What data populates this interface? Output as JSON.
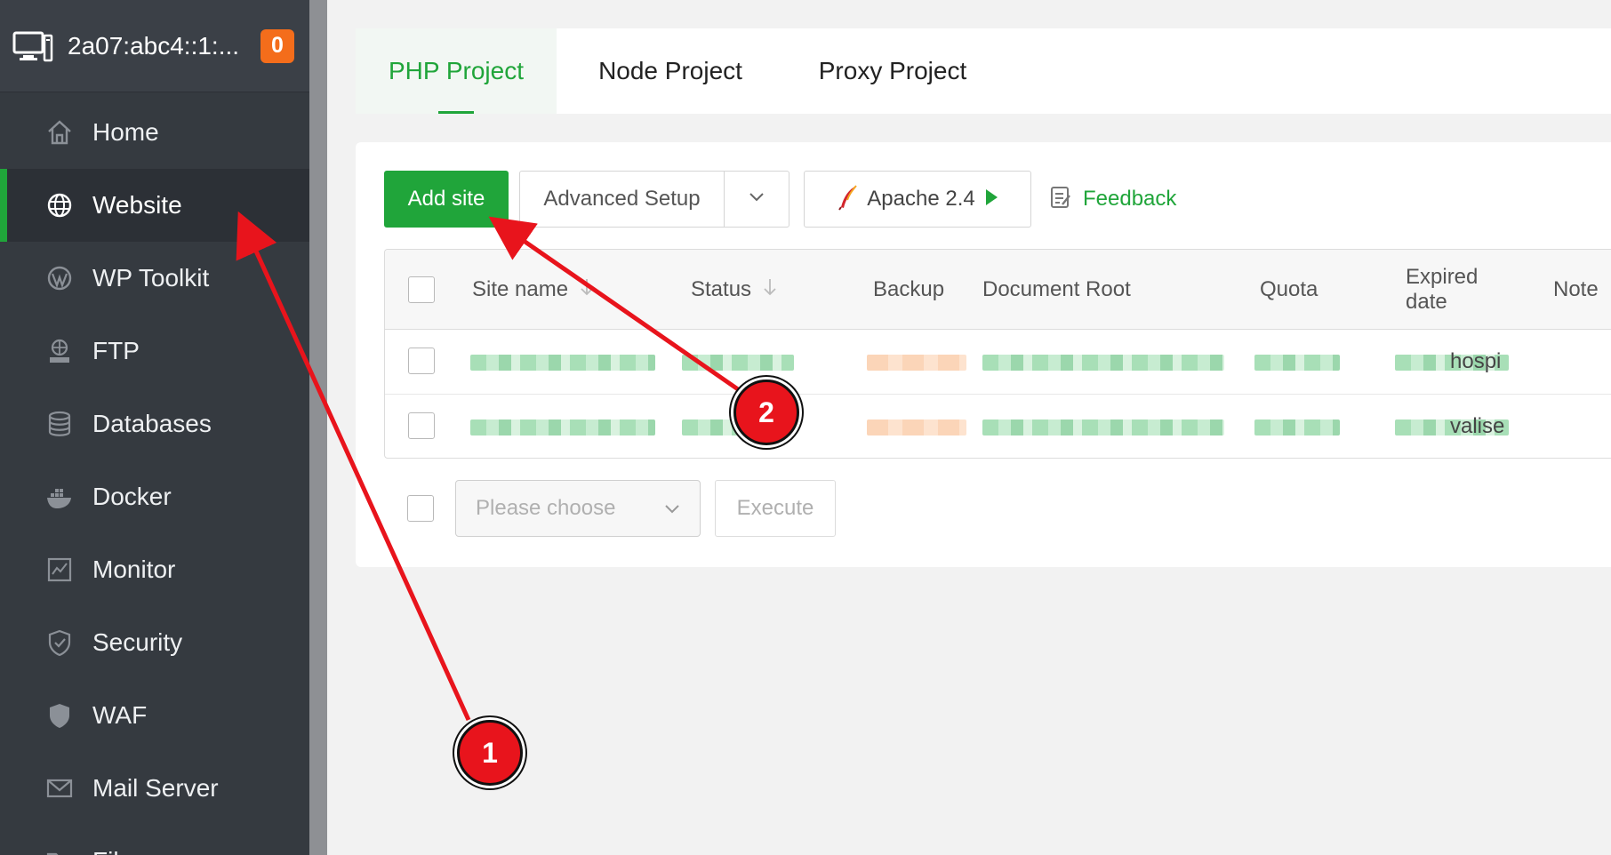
{
  "sidebar": {
    "server_name": "2a07:abc4::1:...",
    "badge_count": "0",
    "items": [
      {
        "label": "Home",
        "icon": "home-icon"
      },
      {
        "label": "Website",
        "icon": "globe-icon"
      },
      {
        "label": "WP Toolkit",
        "icon": "wordpress-icon"
      },
      {
        "label": "FTP",
        "icon": "ftp-icon"
      },
      {
        "label": "Databases",
        "icon": "database-icon"
      },
      {
        "label": "Docker",
        "icon": "docker-icon"
      },
      {
        "label": "Monitor",
        "icon": "monitor-chart-icon"
      },
      {
        "label": "Security",
        "icon": "shield-icon"
      },
      {
        "label": "WAF",
        "icon": "waf-shield-icon"
      },
      {
        "label": "Mail Server",
        "icon": "mail-icon"
      },
      {
        "label": "Files",
        "icon": "folder-icon"
      }
    ],
    "active_item": "Website"
  },
  "tabs": [
    {
      "label": "PHP Project",
      "active": true
    },
    {
      "label": "Node Project",
      "active": false
    },
    {
      "label": "Proxy Project",
      "active": false
    }
  ],
  "toolbar": {
    "add_site_label": "Add site",
    "advanced_setup_label": "Advanced Setup",
    "apache_label": "Apache 2.4",
    "feedback_label": "Feedback"
  },
  "table": {
    "columns": {
      "site_name": "Site name",
      "status": "Status",
      "backup": "Backup",
      "document_root": "Document Root",
      "quota": "Quota",
      "expired_date": "Expired date",
      "note": "Note"
    },
    "rows": [
      {
        "note": "hospi"
      },
      {
        "note": "valise"
      }
    ]
  },
  "batch": {
    "select_placeholder": "Please choose",
    "execute_label": "Execute"
  },
  "annotations": {
    "step1": "1",
    "step2": "2"
  },
  "colors": {
    "accent": "#20a53a",
    "sidebar_bg": "#353a40",
    "badge": "#f46d1b",
    "annotation": "#e8141c"
  }
}
